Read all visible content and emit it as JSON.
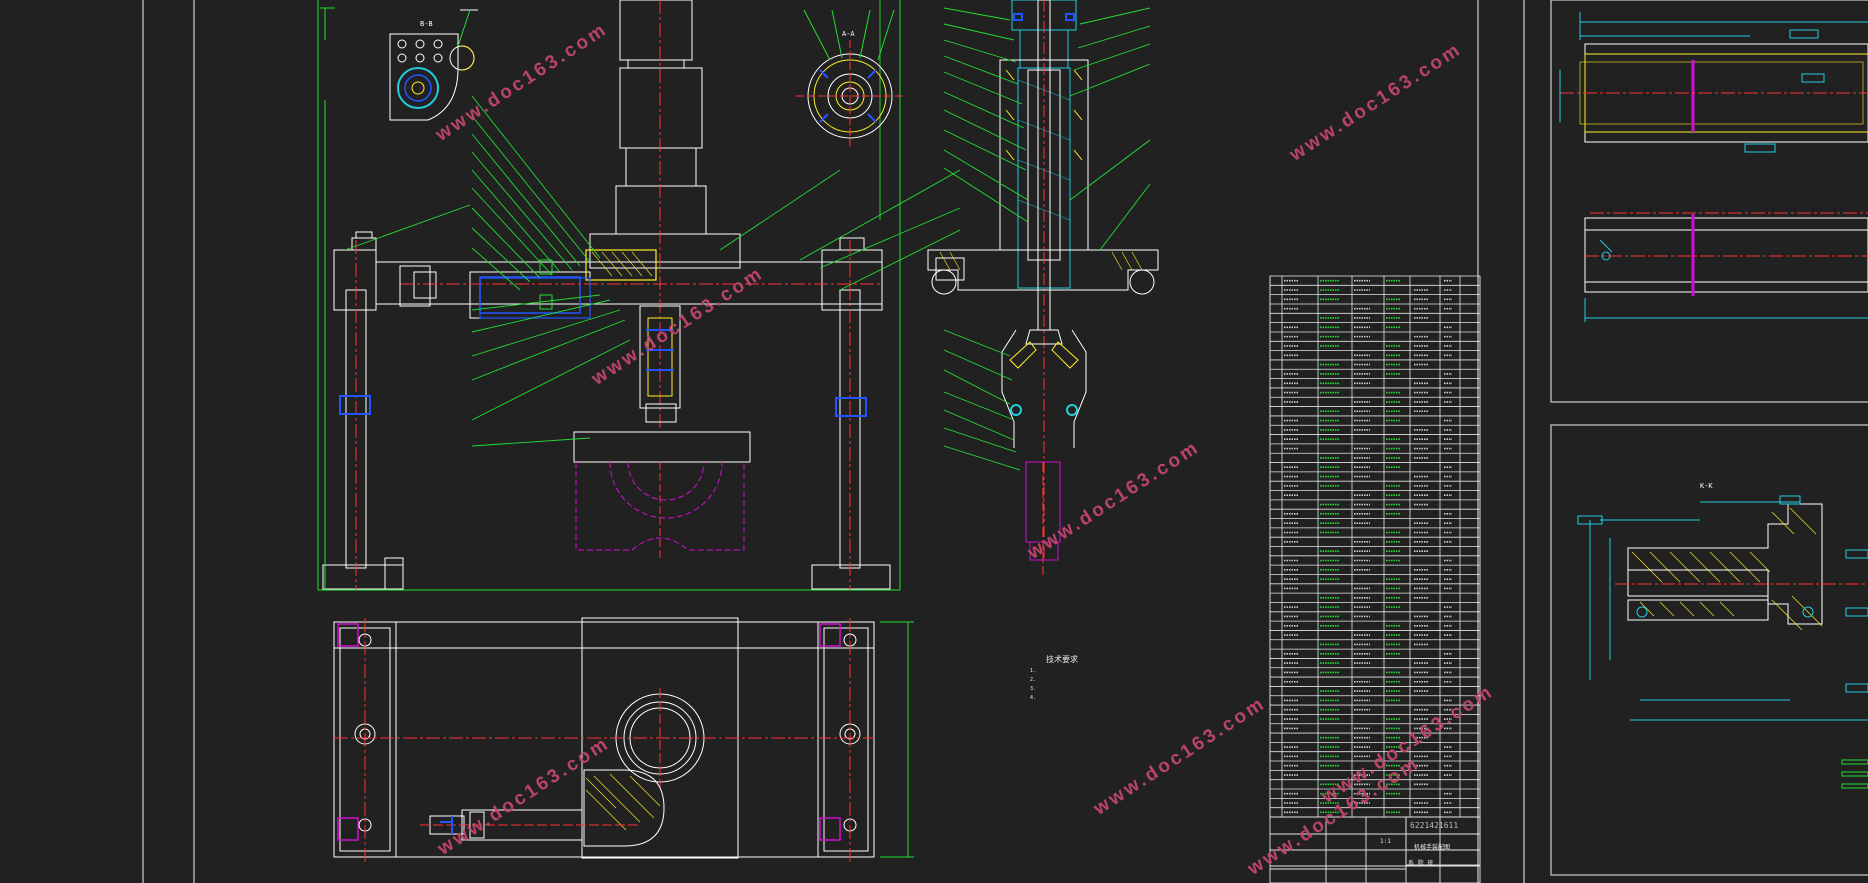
{
  "watermarks": [
    "www.doc163.com",
    "www.doc163.com",
    "www.doc163.com",
    "www.doc163.com",
    "www.doc163.com",
    "www.doc163.com",
    "www.doc163.com",
    "www.doc163.com"
  ],
  "views": {
    "section_bb": "B-B",
    "section_aa": "A-A",
    "section_kk": "K-K"
  },
  "technical_notes": {
    "title": "技术要求",
    "items": [
      "1.",
      "2.",
      "3.",
      "4."
    ]
  },
  "title_block": {
    "drawing_no": "6221421611",
    "name": "机械手装配图",
    "school": "系 院 班",
    "scale": "1:1"
  },
  "colors": {
    "background": "#212121",
    "outline": "#ffffff",
    "leader": "#22dd33",
    "centerline": "#ff3333",
    "hidden": "#d010d0",
    "dimension": "#22ccdd",
    "section": "#ffee22",
    "hatch_blue": "#2255ff"
  }
}
